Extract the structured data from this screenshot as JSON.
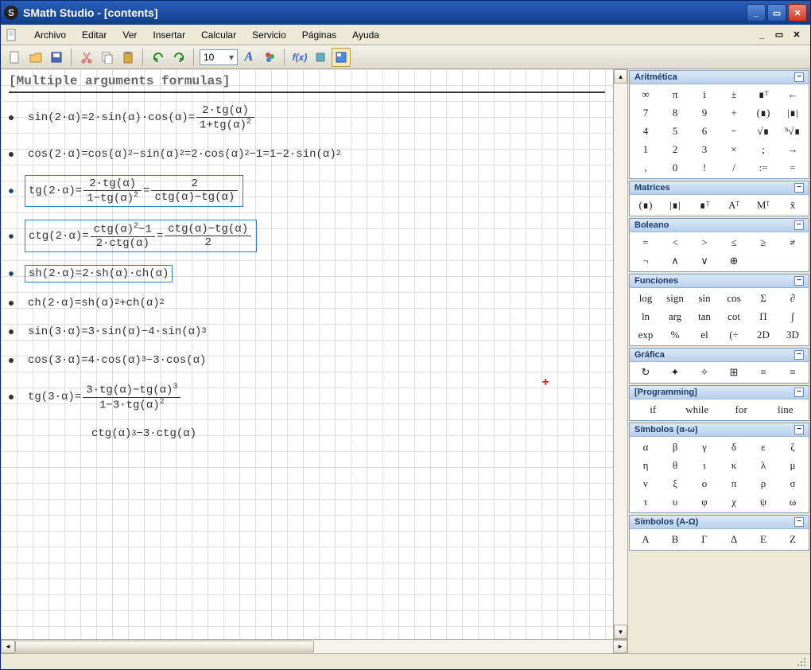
{
  "titlebar": {
    "app_icon": "S",
    "title": "SMath Studio - [contents]"
  },
  "menu": {
    "archivo": "Archivo",
    "editar": "Editar",
    "ver": "Ver",
    "insertar": "Insertar",
    "calcular": "Calcular",
    "servicio": "Servicio",
    "paginas": "Páginas",
    "ayuda": "Ayuda"
  },
  "toolbar": {
    "font_size": "10"
  },
  "document": {
    "title": "[Multiple arguments formulas]",
    "formulas": [
      "sin(2·α)=2·sin(α)·cos(α)= (2·tg(α)) / (1+tg(α)^2)",
      "cos(2·α)=cos(α)^2 − sin(α)^2 = 2·cos(α)^2 − 1 = 1 − 2·sin(α)^2",
      "tg(2·α)= (2·tg(α)) / (1−tg(α)^2) = 2 / (ctg(α)−tg(α))",
      "ctg(2·α)= (ctg(α)^2 − 1) / (2·ctg(α)) = (ctg(α)−tg(α)) / 2",
      "sh(2·α)=2·sh(α)·ch(α)",
      "ch(2·α)=sh(α)^2 + ch(α)^2",
      "sin(3·α)=3·sin(α) − 4·sin(α)^3",
      "cos(3·α)=4·cos(α)^3 − 3·cos(α)",
      "tg(3·α)= (3·tg(α)−tg(α)^3) / (1−3·tg(α)^2)",
      "ctg(α)^3 − 3·ctg(α)"
    ]
  },
  "panels": {
    "aritmetica": {
      "title": "Aritmética",
      "cells": [
        "∞",
        "π",
        "i",
        "±",
        "∎ᵀ",
        "←",
        "7",
        "8",
        "9",
        "+",
        "(∎)",
        "|∎|",
        "4",
        "5",
        "6",
        "−",
        "√∎",
        "ᵇ√∎",
        "1",
        "2",
        "3",
        "×",
        ";",
        "→",
        ",",
        "0",
        "!",
        "/",
        ":=",
        "="
      ]
    },
    "matrices": {
      "title": "Matrices",
      "cells": [
        "(∎)",
        "|∎|",
        "∎ᵀ",
        "Aᵀ",
        "Mᵀ",
        "x̄"
      ]
    },
    "boleano": {
      "title": "Boleano",
      "cells": [
        "=",
        "<",
        ">",
        "≤",
        "≥",
        "≠",
        "¬",
        "∧",
        "∨",
        "⊕",
        "",
        ""
      ]
    },
    "funciones": {
      "title": "Funciones",
      "cells": [
        "log",
        "sign",
        "sin",
        "cos",
        "Σ",
        "∂",
        "ln",
        "arg",
        "tan",
        "cot",
        "Π",
        "∫",
        "exp",
        "%",
        "el",
        "(÷",
        "2D",
        "3D"
      ]
    },
    "grafica": {
      "title": "Gráfica",
      "cells": [
        "↻",
        "✦",
        "✧",
        "⊞",
        "≡",
        "≡"
      ]
    },
    "programming": {
      "title": "[Programming]",
      "cells": [
        "if",
        "while",
        "for",
        "line"
      ]
    },
    "simbolos_lower": {
      "title": "Símbolos (α-ω)",
      "cells": [
        "α",
        "β",
        "γ",
        "δ",
        "ε",
        "ζ",
        "η",
        "θ",
        "ι",
        "κ",
        "λ",
        "μ",
        "ν",
        "ξ",
        "ο",
        "π",
        "ρ",
        "σ",
        "τ",
        "υ",
        "φ",
        "χ",
        "ψ",
        "ω"
      ]
    },
    "simbolos_upper": {
      "title": "Símbolos (A-Ω)",
      "cells": [
        "A",
        "B",
        "Γ",
        "Δ",
        "E",
        "Z"
      ]
    }
  }
}
